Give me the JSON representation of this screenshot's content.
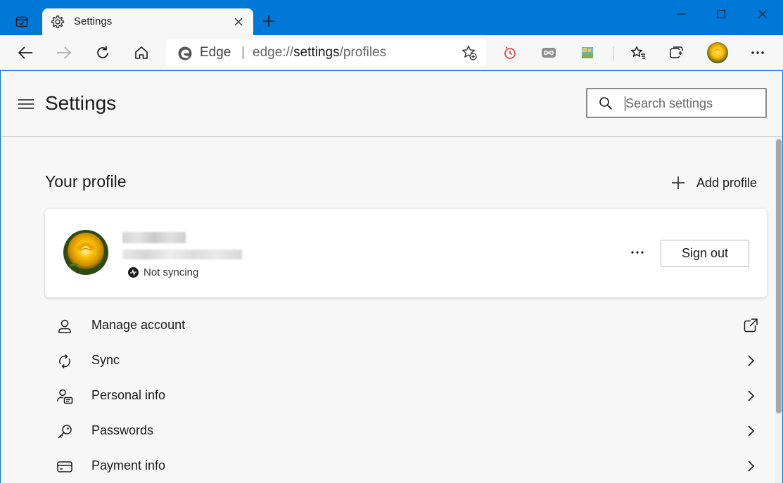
{
  "browser": {
    "tab": {
      "title": "Settings"
    },
    "address": {
      "brand": "Edge",
      "separator": "|",
      "url_prefix": "edge://",
      "url_host": "settings",
      "url_path": "/profiles"
    }
  },
  "settings": {
    "page_title": "Settings",
    "search": {
      "placeholder": "Search settings"
    }
  },
  "profile": {
    "section_title": "Your profile",
    "add_profile_label": "Add profile",
    "sync_status": "Not syncing",
    "sign_out_label": "Sign out"
  },
  "menu": {
    "items": [
      {
        "label": "Manage account",
        "icon": "person-icon",
        "trailing": "external-link-icon"
      },
      {
        "label": "Sync",
        "icon": "sync-icon",
        "trailing": "chevron-right-icon"
      },
      {
        "label": "Personal info",
        "icon": "person-card-icon",
        "trailing": "chevron-right-icon"
      },
      {
        "label": "Passwords",
        "icon": "key-icon",
        "trailing": "chevron-right-icon"
      },
      {
        "label": "Payment info",
        "icon": "credit-card-icon",
        "trailing": "chevron-right-icon"
      }
    ]
  },
  "colors": {
    "accent": "#0078d7",
    "page_bg": "#f7f7f7",
    "card_bg": "#ffffff"
  }
}
